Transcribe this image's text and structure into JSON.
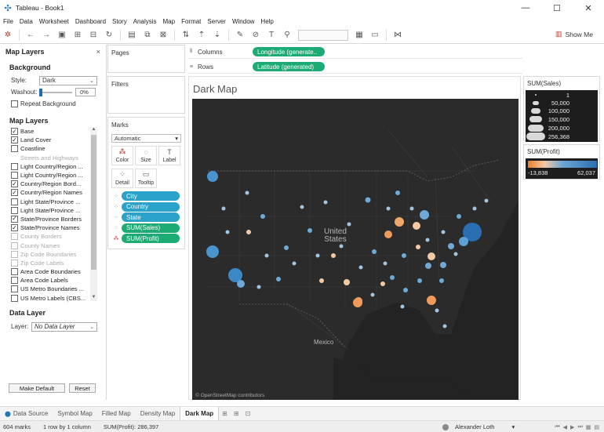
{
  "window": {
    "title": "Tableau - Book1",
    "controls": [
      "—",
      "☐",
      "✕"
    ]
  },
  "menu": [
    "File",
    "Data",
    "Worksheet",
    "Dashboard",
    "Story",
    "Analysis",
    "Map",
    "Format",
    "Server",
    "Window",
    "Help"
  ],
  "toolbar": {
    "show_me_label": "Show Me"
  },
  "map_layers_panel": {
    "title": "Map Layers",
    "close": "×",
    "background": {
      "heading": "Background",
      "style_label": "Style:",
      "style_value": "Dark",
      "washout_label": "Washout:",
      "washout_value": "0%",
      "repeat_background_label": "Repeat Background",
      "repeat_background_checked": false
    },
    "layers": {
      "heading": "Map Layers",
      "items": [
        {
          "label": "Base",
          "checked": true,
          "enabled": true,
          "checkbox": true
        },
        {
          "label": "Land Cover",
          "checked": true,
          "enabled": true,
          "checkbox": true
        },
        {
          "label": "Coastline",
          "checked": false,
          "enabled": true,
          "checkbox": true
        },
        {
          "label": "Streets and Highways",
          "checked": false,
          "enabled": false,
          "checkbox": false
        },
        {
          "label": "Light Country/Region ...",
          "checked": false,
          "enabled": true,
          "checkbox": true
        },
        {
          "label": "Light Country/Region ...",
          "checked": false,
          "enabled": true,
          "checkbox": true
        },
        {
          "label": "Country/Region Bord...",
          "checked": true,
          "enabled": true,
          "checkbox": true
        },
        {
          "label": "Country/Region Names",
          "checked": true,
          "enabled": true,
          "checkbox": true
        },
        {
          "label": "Light State/Province ...",
          "checked": false,
          "enabled": true,
          "checkbox": true
        },
        {
          "label": "Light State/Province ...",
          "checked": false,
          "enabled": true,
          "checkbox": true
        },
        {
          "label": "State/Province Borders",
          "checked": true,
          "enabled": true,
          "checkbox": true
        },
        {
          "label": "State/Province Names",
          "checked": true,
          "enabled": true,
          "checkbox": true
        },
        {
          "label": "County Borders",
          "checked": false,
          "enabled": false,
          "checkbox": true
        },
        {
          "label": "County Names",
          "checked": false,
          "enabled": false,
          "checkbox": true
        },
        {
          "label": "Zip Code Boundaries",
          "checked": false,
          "enabled": false,
          "checkbox": true
        },
        {
          "label": "Zip Code Labels",
          "checked": false,
          "enabled": false,
          "checkbox": true
        },
        {
          "label": "Area Code Boundaries",
          "checked": false,
          "enabled": true,
          "checkbox": true
        },
        {
          "label": "Area Code Labels",
          "checked": false,
          "enabled": true,
          "checkbox": true
        },
        {
          "label": "US Metro Boundaries ...",
          "checked": false,
          "enabled": true,
          "checkbox": true
        },
        {
          "label": "US Metro Labels (CBS...",
          "checked": false,
          "enabled": true,
          "checkbox": true
        }
      ]
    },
    "data_layer": {
      "heading": "Data Layer",
      "layer_label": "Layer:",
      "layer_value": "No Data Layer"
    },
    "make_default_label": "Make Default",
    "reset_label": "Reset"
  },
  "pages_card": {
    "title": "Pages"
  },
  "filters_card": {
    "title": "Filters"
  },
  "marks_card": {
    "title": "Marks",
    "mark_type": "Automatic",
    "buttons": [
      {
        "label": "Color",
        "icon": "color-icon"
      },
      {
        "label": "Size",
        "icon": "size-icon"
      },
      {
        "label": "Label",
        "icon": "label-icon"
      },
      {
        "label": "Detail",
        "icon": "detail-icon"
      },
      {
        "label": "Tooltip",
        "icon": "tooltip-icon"
      }
    ],
    "fields": [
      {
        "label": "City",
        "kind": "dimension",
        "encoding": "detail"
      },
      {
        "label": "Country",
        "kind": "dimension",
        "encoding": "detail"
      },
      {
        "label": "State",
        "kind": "dimension",
        "encoding": "detail"
      },
      {
        "label": "SUM(Sales)",
        "kind": "measure",
        "encoding": "size"
      },
      {
        "label": "SUM(Profit)",
        "kind": "measure",
        "encoding": "color"
      }
    ]
  },
  "columns_shelf": {
    "label": "Columns",
    "pill": "Longitude (generate.."
  },
  "rows_shelf": {
    "label": "Rows",
    "pill": "Latitude (generated)"
  },
  "viz": {
    "title": "Dark Map",
    "attribution": "© OpenStreetMap contributors",
    "labels": {
      "country_us": "United\nStates",
      "mexico": "Mexico"
    }
  },
  "size_legend": {
    "title": "SUM(Sales)",
    "values": [
      "1",
      "50,000",
      "100,000",
      "150,000",
      "200,000",
      "256,368"
    ]
  },
  "color_legend": {
    "title": "SUM(Profit)",
    "min": "-13,838",
    "max": "62,037",
    "colors": {
      "negative": "#e57f2e",
      "positive": "#2a6fb3"
    }
  },
  "tabs": {
    "data_source": "Data Source",
    "sheets": [
      "Symbol Map",
      "Filled Map",
      "Density Map",
      "Dark Map"
    ],
    "active": "Dark Map"
  },
  "status": {
    "marks": "604 marks",
    "dimensions": "1 row by 1 column",
    "sum": "SUM(Profit): 286,397",
    "user": "Alexander Loth"
  }
}
